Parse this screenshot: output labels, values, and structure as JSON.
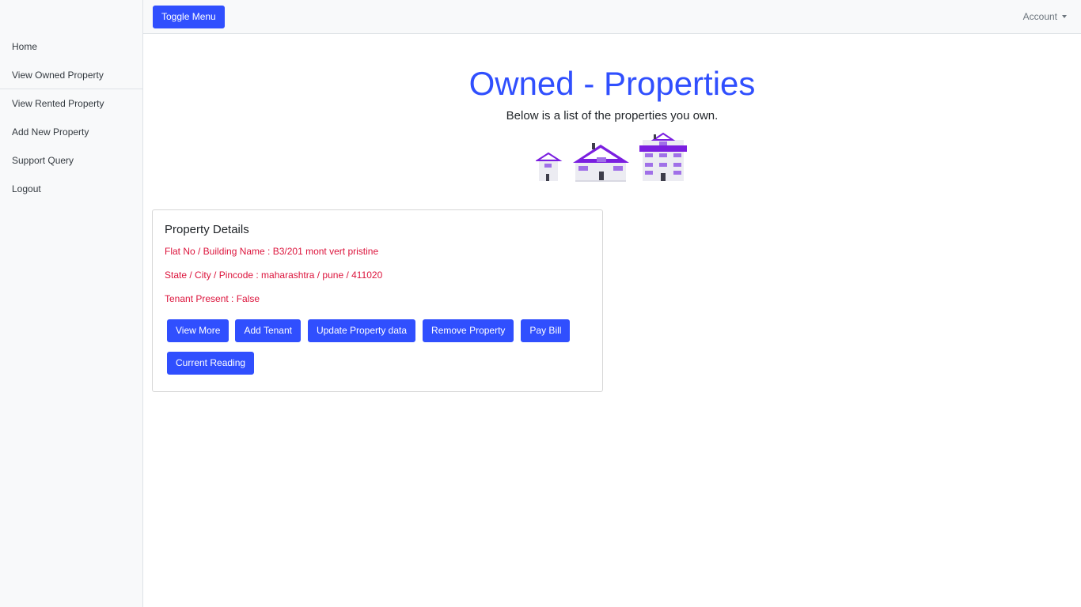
{
  "sidebar": {
    "items": [
      {
        "label": "Home"
      },
      {
        "label": "View Owned Property"
      },
      {
        "label": "View Rented Property"
      },
      {
        "label": "Add New Property"
      },
      {
        "label": "Support Query"
      },
      {
        "label": "Logout"
      }
    ]
  },
  "topbar": {
    "toggle_label": "Toggle Menu",
    "account_label": "Account"
  },
  "main": {
    "title": "Owned - Properties",
    "subtitle": "Below is a list of the properties you own.",
    "illustration_icon": "buildings-icon"
  },
  "card": {
    "title": "Property Details",
    "flat": "Flat No / Building Name : B3/201 mont vert pristine",
    "location": "State / City / Pincode : maharashtra / pune / 411020",
    "tenant": "Tenant Present : False",
    "buttons": {
      "view_more": "View More",
      "add_tenant": "Add Tenant",
      "update": "Update Property data",
      "remove": "Remove Property",
      "pay_bill": "Pay Bill",
      "current_reading": "Current Reading"
    }
  },
  "colors": {
    "accent": "#304ffe",
    "detail_text": "#dc143c",
    "sidebar_bg": "#f8f9fa",
    "illustration_purple": "#7b1fe0"
  }
}
